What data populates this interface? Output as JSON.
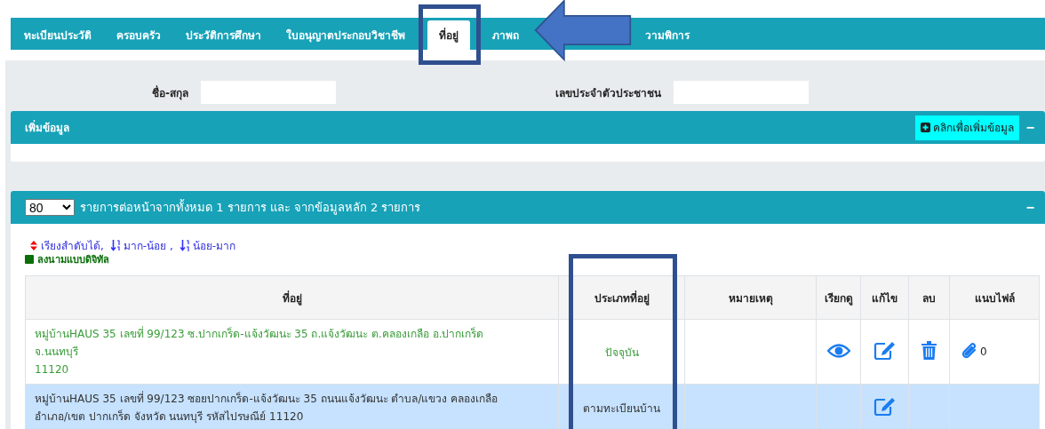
{
  "tabs": [
    {
      "label": "ทะเบียนประวัติ",
      "selected": false
    },
    {
      "label": "ครอบครัว",
      "selected": false
    },
    {
      "label": "ประวัติการศึกษา",
      "selected": false
    },
    {
      "label": "ใบอนุญาตประกอบวิชาชีพ",
      "selected": false
    },
    {
      "label": "ที่อยู่",
      "selected": true
    },
    {
      "label": "ภาพถ",
      "selected": false
    },
    {
      "label": "วามพิการ",
      "selected": false
    }
  ],
  "search": {
    "fields": [
      {
        "label": "ชื่อ-สกุล"
      },
      {
        "label": "เลขประจำตัวประชาชน"
      }
    ]
  },
  "add_panel": {
    "title": "เพิ่มข้อมูล",
    "button": "คลิกเพื่อเพิ่มข้อมูล",
    "collapse": "−"
  },
  "list_panel": {
    "page_size": "80",
    "summary": "รายการต่อหน้าจากทั้งหมด 1 รายการ และ จากข้อมูลหลัก 2 รายการ",
    "collapse": "−",
    "legend": {
      "sortable": "เรียงสำดับได้,",
      "desc": "มาก-น้อย ,",
      "asc": "น้อย-มาก",
      "signed": "ลงนามแบบดิจิทัล"
    }
  },
  "table": {
    "columns": [
      "ที่อยู่",
      "ประเภทที่อยู่",
      "หมายเหตุ",
      "เรียกดู",
      "แก้ไข",
      "ลบ",
      "แนบไฟล์"
    ],
    "rows": [
      {
        "kind": "current",
        "highlighted": false,
        "address_lines": [
          "หมู่บ้านHAUS 35 เลขที่ 99/123 ซ.ปากเกร็ด-แจ้งวัฒนะ 35 ถ.แจ้งวัฒนะ ต.คลองเกลือ อ.ปากเกร็ด",
          "จ.นนทบุรี",
          "11120"
        ],
        "type": "ปัจจุบัน",
        "view": true,
        "edit": true,
        "delete": true,
        "attachments": "0"
      },
      {
        "kind": "registered",
        "highlighted": true,
        "address_lines": [
          "หมู่บ้านHAUS 35 เลขที่ 99/123 ซอยปากเกร็ด-แจ้งวัฒนะ 35 ถนนแจ้งวัฒนะ ตำบล/แขวง คลองเกลือ",
          "อำเภอ/เขต ปากเกร็ด จังหวัด นนทบุรี รหัสไปรษณีย์ 11120"
        ],
        "type": "ตามทะเบียนบ้าน",
        "view": false,
        "edit": true,
        "delete": false
      }
    ]
  }
}
